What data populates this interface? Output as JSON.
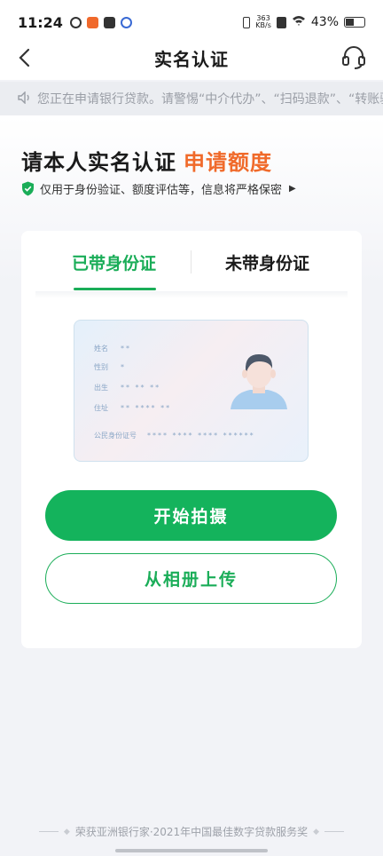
{
  "status_bar": {
    "time": "11:24",
    "net_speed_value": "363",
    "net_speed_unit": "KB/s",
    "battery_percent": "43%"
  },
  "nav": {
    "title": "实名认证",
    "back_icon": "chevron-left-icon",
    "service_icon": "headset-icon"
  },
  "notice": {
    "icon": "speaker-icon",
    "text": "您正在申请银行贷款。请警惕“中介代办”、“扫码退款”、“转账验证”"
  },
  "hero": {
    "title": "请本人实名认证",
    "title_accent": "申请额度",
    "subtitle": "仅用于身份验证、额度评估等，信息将严格保密",
    "accent_color": "#f06a2a"
  },
  "tabs": [
    {
      "label": "已带身份证",
      "active": true
    },
    {
      "label": "未带身份证",
      "active": false
    }
  ],
  "id_card": {
    "name_label": "姓名",
    "name_value": "**",
    "gender_label": "性别",
    "gender_value": "*",
    "birth_label": "出生",
    "birth_value": "** ** **",
    "address_label": "住址",
    "address_value": "** **** **",
    "id_label": "公民身份证号",
    "id_value": "**** **** **** ******"
  },
  "buttons": {
    "capture": "开始拍摄",
    "upload": "从相册上传"
  },
  "footer": {
    "text": "荣获亚洲银行家·2021年中国最佳数字贷款服务奖"
  },
  "colors": {
    "brand_green": "#1aad58",
    "button_green": "#14b35c"
  }
}
